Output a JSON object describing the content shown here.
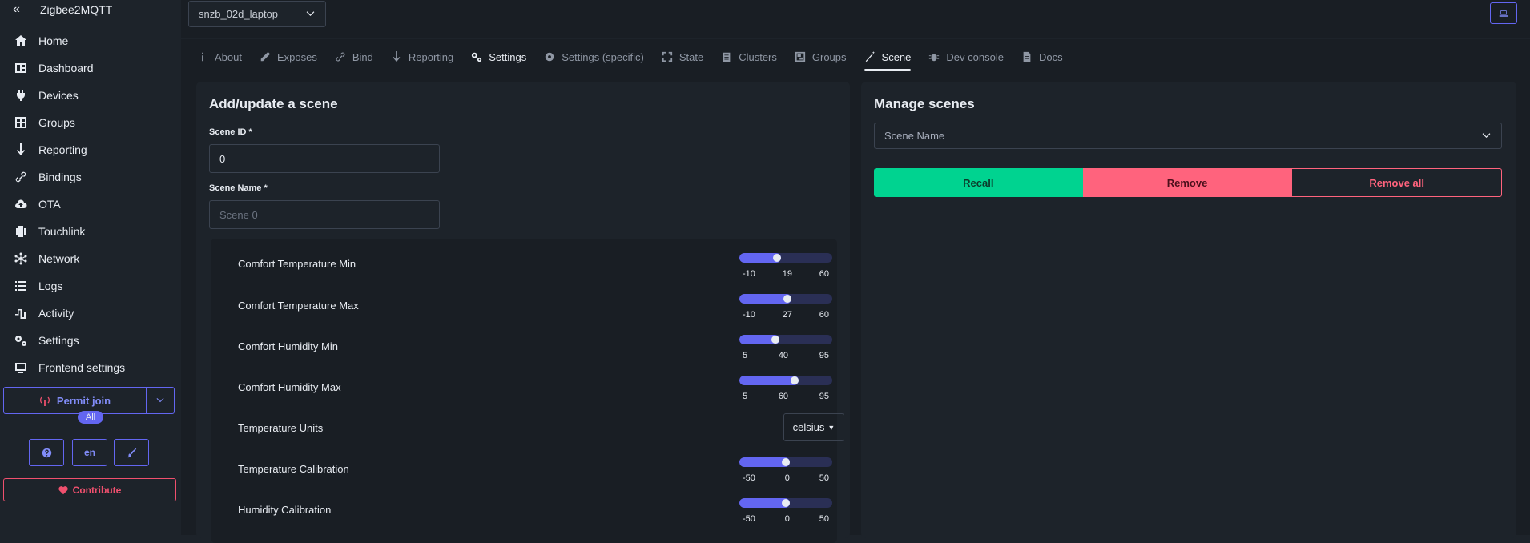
{
  "app": {
    "title": "Zigbee2MQTT"
  },
  "sidebar": {
    "items": [
      {
        "label": "Home",
        "icon": "home-icon"
      },
      {
        "label": "Dashboard",
        "icon": "dashboard-icon"
      },
      {
        "label": "Devices",
        "icon": "plug-icon"
      },
      {
        "label": "Groups",
        "icon": "groups-icon"
      },
      {
        "label": "Reporting",
        "icon": "arrow-down-icon"
      },
      {
        "label": "Bindings",
        "icon": "link-icon"
      },
      {
        "label": "OTA",
        "icon": "cloud-upload-icon"
      },
      {
        "label": "Touchlink",
        "icon": "vibrate-icon"
      },
      {
        "label": "Network",
        "icon": "network-icon"
      },
      {
        "label": "Logs",
        "icon": "list-icon"
      },
      {
        "label": "Activity",
        "icon": "wave-icon"
      },
      {
        "label": "Settings",
        "icon": "gears-icon"
      },
      {
        "label": "Frontend settings",
        "icon": "monitor-icon"
      }
    ],
    "permit_join_label": "Permit join",
    "permit_badge": "All",
    "lang_label": "en",
    "contribute_label": "Contribute"
  },
  "device_select": {
    "value": "snzb_02d_laptop"
  },
  "tabs": [
    {
      "label": "About",
      "icon": "info-icon"
    },
    {
      "label": "Exposes",
      "icon": "wand-icon"
    },
    {
      "label": "Bind",
      "icon": "link-icon"
    },
    {
      "label": "Reporting",
      "icon": "arrow-down-icon"
    },
    {
      "label": "Settings",
      "icon": "gears-icon"
    },
    {
      "label": "Settings (specific)",
      "icon": "gear-icon"
    },
    {
      "label": "State",
      "icon": "expand-icon"
    },
    {
      "label": "Clusters",
      "icon": "clipboard-icon"
    },
    {
      "label": "Groups",
      "icon": "object-group-icon"
    },
    {
      "label": "Scene",
      "icon": "magic-wand-icon"
    },
    {
      "label": "Dev console",
      "icon": "bug-icon"
    },
    {
      "label": "Docs",
      "icon": "doc-icon"
    }
  ],
  "add_scene": {
    "title": "Add/update a scene",
    "scene_id_label": "Scene ID *",
    "scene_id_value": "0",
    "scene_name_label": "Scene Name *",
    "scene_name_placeholder": "Scene 0",
    "rows": [
      {
        "label": "Comfort Temperature Min",
        "min": "-10",
        "value": "19",
        "max": "60",
        "fraction": 0.4
      },
      {
        "label": "Comfort Temperature Max",
        "min": "-10",
        "value": "27",
        "max": "60",
        "fraction": 0.52
      },
      {
        "label": "Comfort Humidity Min",
        "min": "5",
        "value": "40",
        "max": "95",
        "fraction": 0.38
      },
      {
        "label": "Comfort Humidity Max",
        "min": "5",
        "value": "60",
        "max": "95",
        "fraction": 0.6
      }
    ],
    "temp_units_label": "Temperature Units",
    "temp_units_value": "celsius",
    "rows2": [
      {
        "label": "Temperature Calibration",
        "min": "-50",
        "value": "0",
        "max": "50",
        "fraction": 0.5
      },
      {
        "label": "Humidity Calibration",
        "min": "-50",
        "value": "0",
        "max": "50",
        "fraction": 0.5
      }
    ]
  },
  "manage_scenes": {
    "title": "Manage scenes",
    "select_placeholder": "Scene Name",
    "recall_label": "Recall",
    "remove_label": "Remove",
    "remove_all_label": "Remove all"
  },
  "colors": {
    "accent": "#6366f1",
    "success": "#00d390",
    "error": "#ff637d"
  }
}
